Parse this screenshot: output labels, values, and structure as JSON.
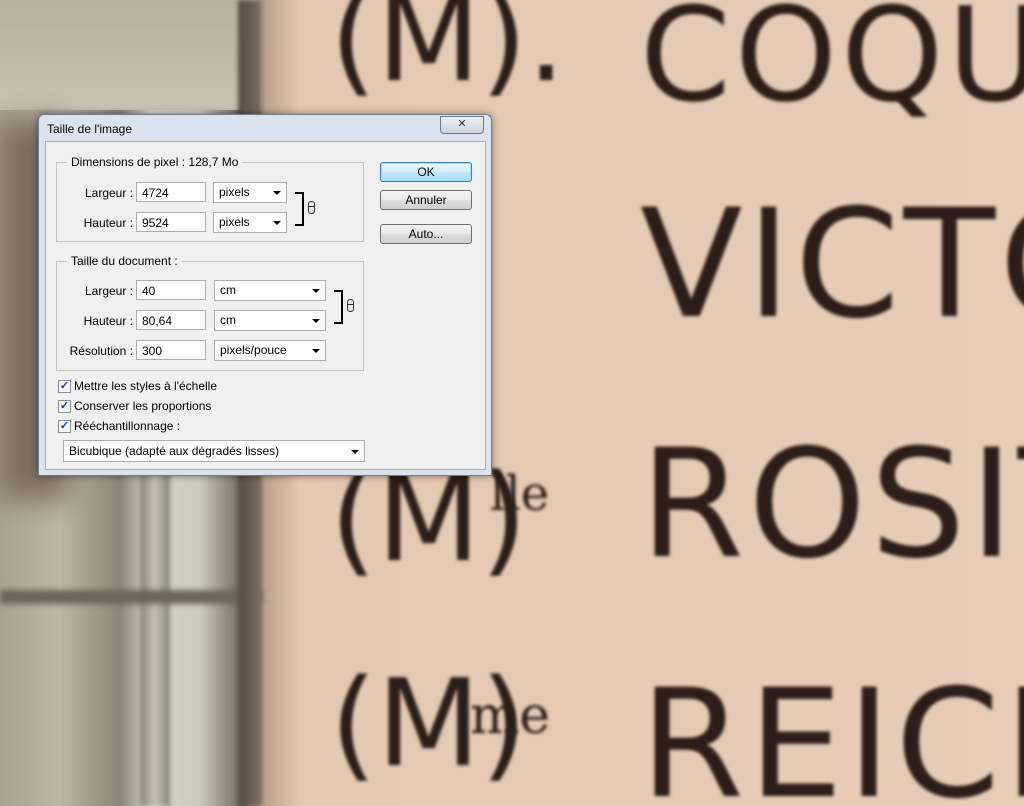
{
  "background": {
    "lines": [
      {
        "prefix": "(M).",
        "word": "COQU"
      },
      {
        "prefix": "",
        "word": "VICTOI"
      },
      {
        "prefix": "(M)",
        "suffix": "lle",
        "word": "ROSIT"
      },
      {
        "prefix": "(M)",
        "suffix": "me",
        "word": "REICH"
      }
    ]
  },
  "dialog": {
    "title": "Taille de l'image",
    "close_glyph": "✕",
    "pixel_dims": {
      "legend": "Dimensions de pixel : ",
      "size": "128,7 Mo",
      "width_label": "Largeur :",
      "width_value": "4724",
      "width_unit": "pixels",
      "height_label": "Hauteur :",
      "height_value": "9524",
      "height_unit": "pixels"
    },
    "doc_size": {
      "legend": "Taille du document :",
      "width_label": "Largeur :",
      "width_value": "40",
      "width_unit": "cm",
      "height_label": "Hauteur :",
      "height_value": "80,64",
      "height_unit": "cm",
      "res_label": "Résolution :",
      "res_value": "300",
      "res_unit": "pixels/pouce"
    },
    "buttons": {
      "ok": "OK",
      "cancel": "Annuler",
      "auto": "Auto..."
    },
    "options": {
      "scale_styles": {
        "label": "Mettre les styles à l'échelle",
        "checked": true
      },
      "constrain": {
        "label": "Conserver les proportions",
        "checked": true
      },
      "resample": {
        "label": "Rééchantillonnage :",
        "checked": true
      },
      "resample_method": "Bicubique (adapté aux dégradés lisses)"
    },
    "check_glyph": "✓"
  }
}
